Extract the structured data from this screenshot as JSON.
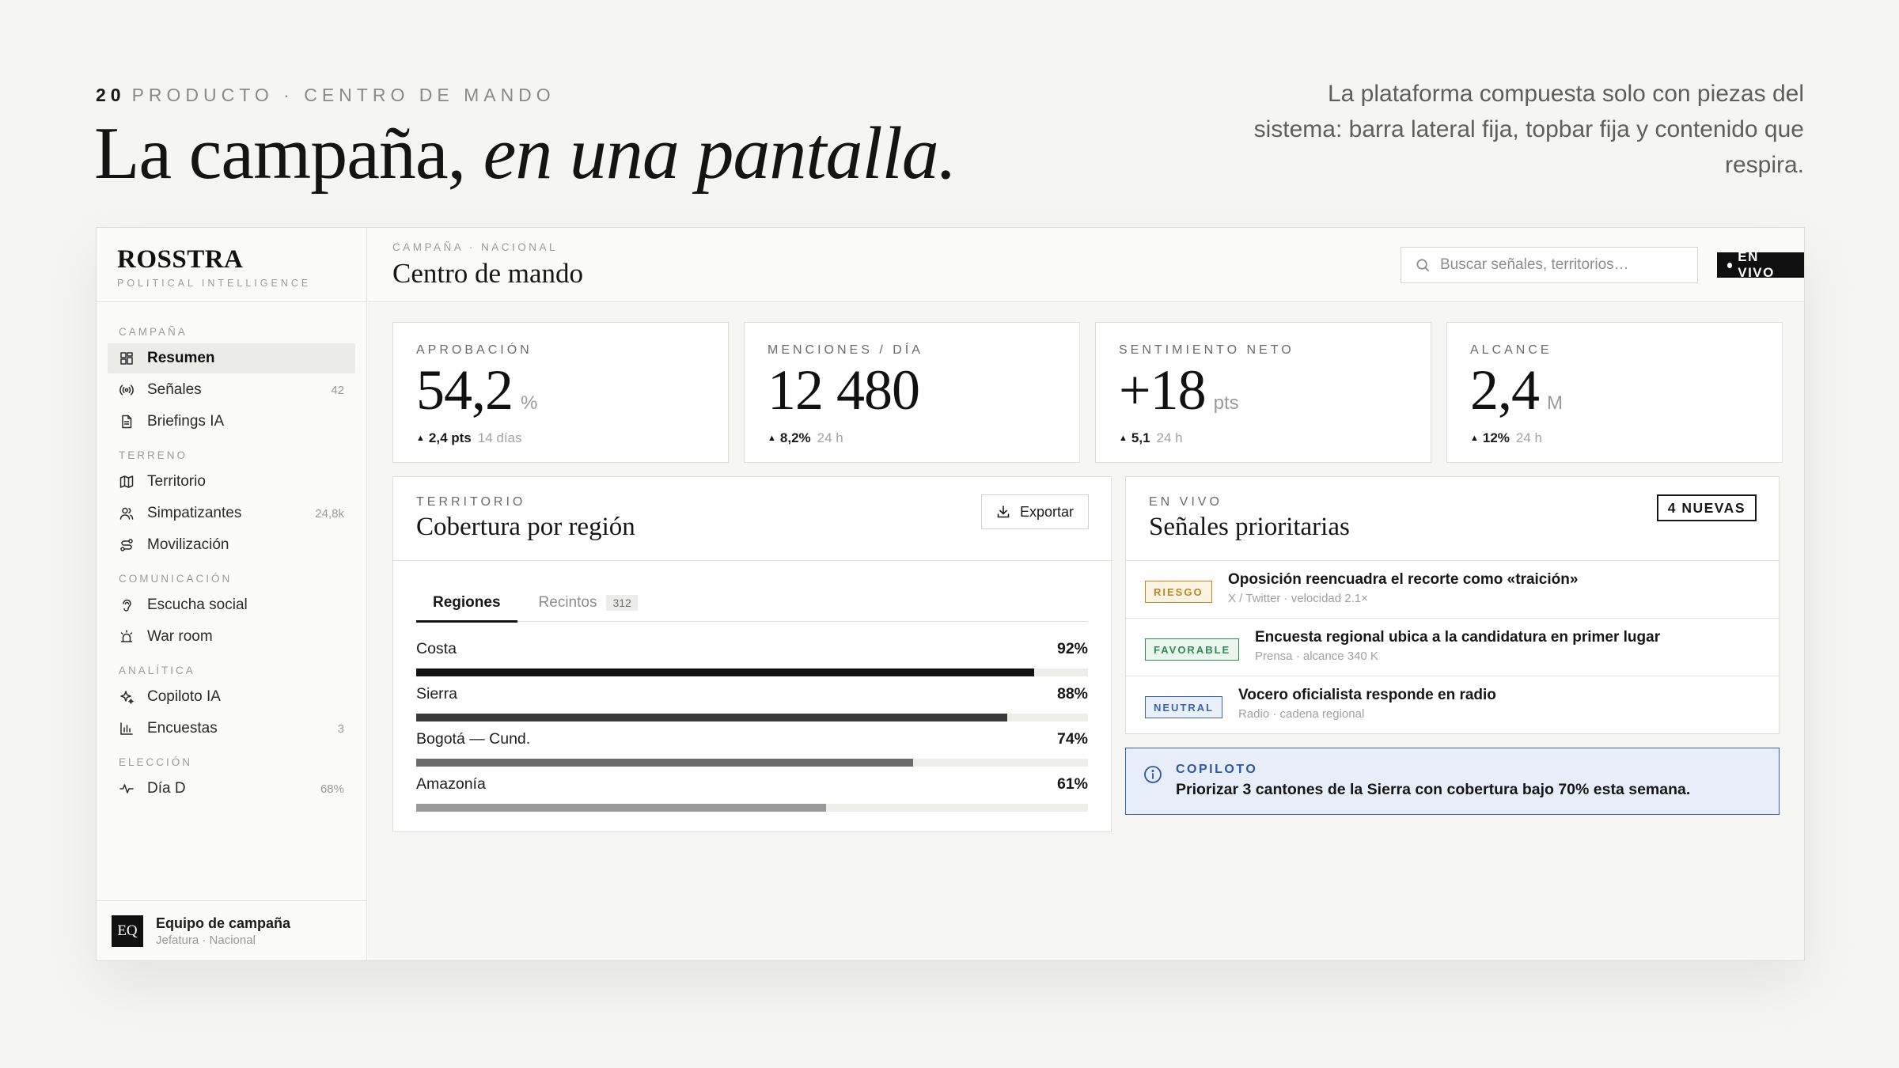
{
  "slide": {
    "number": "20",
    "eyebrow": "PRODUCTO · CENTRO DE MANDO",
    "title_plain": "La campaña, ",
    "title_italic": "en una pantalla.",
    "description": "La plataforma compuesta solo con piezas del sistema: barra lateral fija, topbar fija y contenido que respira."
  },
  "brand": {
    "name": "ROSSTRA",
    "tagline": "POLITICAL INTELLIGENCE"
  },
  "sidebar": {
    "sections": [
      {
        "title": "CAMPAÑA",
        "items": [
          {
            "label": "Resumen",
            "icon": "grid-icon",
            "count": "",
            "active": true
          },
          {
            "label": "Señales",
            "icon": "broadcast-icon",
            "count": "42",
            "active": false
          },
          {
            "label": "Briefings IA",
            "icon": "document-icon",
            "count": "",
            "active": false
          }
        ]
      },
      {
        "title": "TERRENO",
        "items": [
          {
            "label": "Territorio",
            "icon": "map-icon",
            "count": "",
            "active": false
          },
          {
            "label": "Simpatizantes",
            "icon": "users-icon",
            "count": "24,8k",
            "active": false
          },
          {
            "label": "Movilización",
            "icon": "route-icon",
            "count": "",
            "active": false
          }
        ]
      },
      {
        "title": "COMUNICACIÓN",
        "items": [
          {
            "label": "Escucha social",
            "icon": "ear-icon",
            "count": "",
            "active": false
          },
          {
            "label": "War room",
            "icon": "siren-icon",
            "count": "",
            "active": false
          }
        ]
      },
      {
        "title": "ANALÍTICA",
        "items": [
          {
            "label": "Copiloto IA",
            "icon": "sparkle-icon",
            "count": "",
            "active": false
          },
          {
            "label": "Encuestas",
            "icon": "bar-chart-icon",
            "count": "3",
            "active": false
          }
        ]
      },
      {
        "title": "ELECCIÓN",
        "items": [
          {
            "label": "Día D",
            "icon": "pulse-icon",
            "count": "68%",
            "active": false
          }
        ]
      }
    ],
    "user": {
      "initials": "EQ",
      "name": "Equipo de campaña",
      "role": "Jefatura · Nacional"
    }
  },
  "topbar": {
    "breadcrumb": "CAMPAÑA · NACIONAL",
    "title": "Centro de mando",
    "search_placeholder": "Buscar señales, territorios…",
    "live_label": "EN VIVO"
  },
  "kpis": [
    {
      "label": "APROBACIÓN",
      "value": "54,2",
      "unit": "%",
      "delta": "2,4 pts",
      "period": "14 días"
    },
    {
      "label": "MENCIONES / DÍA",
      "value": "12 480",
      "unit": "",
      "delta": "8,2%",
      "period": "24 h"
    },
    {
      "label": "SENTIMIENTO NETO",
      "value": "+18",
      "unit": "pts",
      "delta": "5,1",
      "period": "24 h"
    },
    {
      "label": "ALCANCE",
      "value": "2,4",
      "unit": "M",
      "delta": "12%",
      "period": "24 h"
    }
  ],
  "coverage": {
    "eyebrow": "TERRITORIO",
    "title": "Cobertura por región",
    "export_label": "Exportar",
    "tabs": [
      {
        "label": "Regiones",
        "badge": "",
        "active": true
      },
      {
        "label": "Recintos",
        "badge": "312",
        "active": false
      }
    ],
    "regions": [
      {
        "name": "Costa",
        "pct_label": "92%",
        "value": 92,
        "color": "#111111"
      },
      {
        "name": "Sierra",
        "pct_label": "88%",
        "value": 88,
        "color": "#3a3a3a"
      },
      {
        "name": "Bogotá — Cund.",
        "pct_label": "74%",
        "value": 74,
        "color": "#6b6b6b"
      },
      {
        "name": "Amazonía",
        "pct_label": "61%",
        "value": 61,
        "color": "#9a9a9a"
      }
    ]
  },
  "signals": {
    "eyebrow": "EN VIVO",
    "title": "Señales prioritarias",
    "new_label": "4 NUEVAS",
    "items": [
      {
        "tag": "RIESGO",
        "tag_color": "#b8862b",
        "tag_bg": "#fbf3e2",
        "title": "Oposición reencuadra el recorte como «traición»",
        "meta": "X / Twitter · velocidad 2.1×"
      },
      {
        "tag": "FAVORABLE",
        "tag_color": "#2e8a52",
        "tag_bg": "#eaf6ee",
        "title": "Encuesta regional ubica a la candidatura en primer lugar",
        "meta": "Prensa · alcance 340 K"
      },
      {
        "tag": "NEUTRAL",
        "tag_color": "#3c63b0",
        "tag_bg": "#eaf0fa",
        "title": "Vocero oficialista responde en radio",
        "meta": "Radio · cadena regional"
      }
    ]
  },
  "copilot": {
    "label": "COPILOTO",
    "text": "Priorizar 3 cantones de la Sierra con cobertura bajo 70% esta semana."
  }
}
